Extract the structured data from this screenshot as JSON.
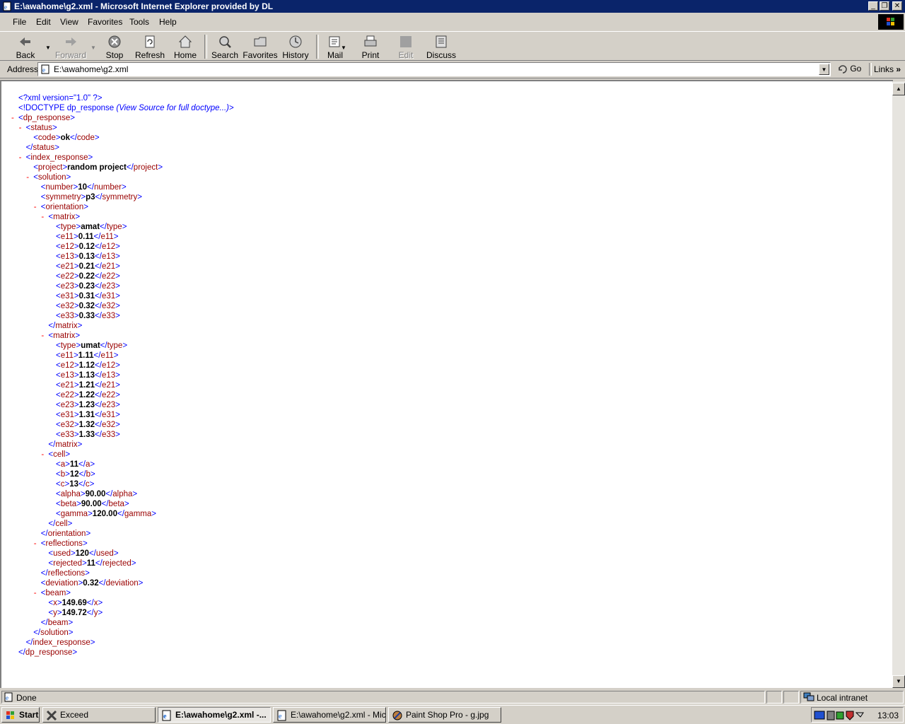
{
  "window": {
    "title": "E:\\awahome\\g2.xml - Microsoft Internet Explorer provided by DL",
    "controls": [
      "minimize",
      "restore",
      "close"
    ]
  },
  "menu": {
    "items": [
      {
        "label": "File"
      },
      {
        "label": "Edit"
      },
      {
        "label": "View"
      },
      {
        "label": "Favorites"
      },
      {
        "label": "Tools"
      },
      {
        "label": "Help"
      }
    ]
  },
  "toolbar": {
    "back": "Back",
    "forward": "Forward",
    "stop": "Stop",
    "refresh": "Refresh",
    "home": "Home",
    "search": "Search",
    "favorites": "Favorites",
    "history": "History",
    "mail": "Mail",
    "print": "Print",
    "edit": "Edit",
    "discuss": "Discuss"
  },
  "address": {
    "label": "Address",
    "value": "E:\\awahome\\g2.xml",
    "go": "Go",
    "links": "Links"
  },
  "xml": {
    "decl": "<?xml version=\"1.0\" ?>",
    "doctype_open": "<!DOCTYPE dp_response",
    "doctype_note": "(View Source for full doctype...)",
    "doctype_close": ">",
    "code": "ok",
    "project": "random project",
    "number": "10",
    "symmetry": "p3",
    "matrices": [
      {
        "type": "amat",
        "elements": [
          {
            "tag": "e11",
            "value": "0.11"
          },
          {
            "tag": "e12",
            "value": "0.12"
          },
          {
            "tag": "e13",
            "value": "0.13"
          },
          {
            "tag": "e21",
            "value": "0.21"
          },
          {
            "tag": "e22",
            "value": "0.22"
          },
          {
            "tag": "e23",
            "value": "0.23"
          },
          {
            "tag": "e31",
            "value": "0.31"
          },
          {
            "tag": "e32",
            "value": "0.32"
          },
          {
            "tag": "e33",
            "value": "0.33"
          }
        ]
      },
      {
        "type": "umat",
        "elements": [
          {
            "tag": "e11",
            "value": "1.11"
          },
          {
            "tag": "e12",
            "value": "1.12"
          },
          {
            "tag": "e13",
            "value": "1.13"
          },
          {
            "tag": "e21",
            "value": "1.21"
          },
          {
            "tag": "e22",
            "value": "1.22"
          },
          {
            "tag": "e23",
            "value": "1.23"
          },
          {
            "tag": "e31",
            "value": "1.31"
          },
          {
            "tag": "e32",
            "value": "1.32"
          },
          {
            "tag": "e33",
            "value": "1.33"
          }
        ]
      }
    ],
    "cell": {
      "a": "11",
      "b": "12",
      "c": "13",
      "alpha": "90.00",
      "beta": "90.00",
      "gamma": "120.00"
    },
    "reflections": {
      "used": "120",
      "rejected": "11"
    },
    "deviation": "0.32",
    "beam": {
      "x": "149.69",
      "y": "149.72"
    }
  },
  "status": {
    "text": "Done",
    "zone": "Local intranet"
  },
  "taskbar": {
    "start": "Start",
    "tasks": [
      {
        "label": "Exceed",
        "active": false
      },
      {
        "label": "E:\\awahome\\g2.xml -...",
        "active": true
      },
      {
        "label": "E:\\awahome\\g2.xml - Micr...",
        "active": false
      },
      {
        "label": "Paint Shop Pro - g.jpg",
        "active": false
      }
    ],
    "clock": "13:03"
  },
  "colors": {
    "titlebar": "#0a246a",
    "tag": "#990000",
    "markup": "#0000ff",
    "collapse_minus": "#ff0000"
  }
}
